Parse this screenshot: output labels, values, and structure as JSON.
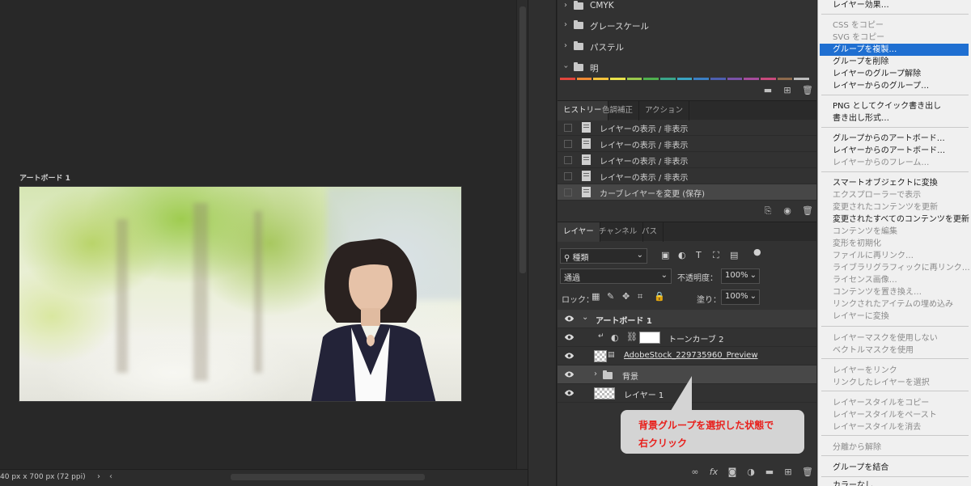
{
  "canvas": {
    "artboard_label": "アートボード 1",
    "status_text": "40 px x 700 px (72 ppi)",
    "status_arrow": "›",
    "scroll_left": "‹"
  },
  "swatches": {
    "groups": [
      {
        "name": "CMYK",
        "expanded": false
      },
      {
        "name": "グレースケール",
        "expanded": false
      },
      {
        "name": "パステル",
        "expanded": false
      },
      {
        "name": "明",
        "expanded": true
      }
    ],
    "strip_colors": [
      "#e2463c",
      "#f08a34",
      "#f5c33b",
      "#e9e24b",
      "#9ac84c",
      "#4fb04e",
      "#3aa58a",
      "#3aa4c2",
      "#3b7fc4",
      "#4d5fb0",
      "#7a52a8",
      "#a64c9c",
      "#c84a7c",
      "#8d6a4c",
      "#bbbbbb"
    ]
  },
  "history": {
    "tabs": [
      "ヒストリー",
      "色調補正",
      "アクション"
    ],
    "items": [
      {
        "label": "レイヤーの表示 / 非表示",
        "current": false
      },
      {
        "label": "レイヤーの表示 / 非表示",
        "current": false
      },
      {
        "label": "レイヤーの表示 / 非表示",
        "current": false
      },
      {
        "label": "レイヤーの表示 / 非表示",
        "current": false
      },
      {
        "label": "カーブレイヤーを変更 (保存)",
        "current": true
      }
    ]
  },
  "layers": {
    "tabs": [
      "レイヤー",
      "チャンネル",
      "パス"
    ],
    "filter_kind": "種類",
    "blend_mode": "通過",
    "opacity_label": "不透明度：",
    "opacity_value": "100%",
    "lock_label": "ロック：",
    "fill_label": "塗り：",
    "fill_value": "100%",
    "rows": [
      {
        "name": "アートボード 1",
        "kind": "artboard"
      },
      {
        "name": "トーンカーブ 2",
        "kind": "adjustment"
      },
      {
        "name": "AdobeStock_229735960_Preview",
        "kind": "smart"
      },
      {
        "name": "背景",
        "kind": "group"
      },
      {
        "name": "レイヤー 1",
        "kind": "pixel"
      }
    ]
  },
  "callout": {
    "line1": "背景グループを選択した状態で",
    "line2": "右クリック"
  },
  "context_menu": {
    "items": [
      {
        "label": "レイヤー効果…",
        "state": "enabled"
      },
      {
        "label": "CSS をコピー",
        "state": "disabled"
      },
      {
        "label": "SVG をコピー",
        "state": "disabled"
      },
      {
        "label": "グループを複製…",
        "state": "highlighted"
      },
      {
        "label": "グループを削除",
        "state": "enabled"
      },
      {
        "label": "レイヤーのグループ解除",
        "state": "enabled"
      },
      {
        "label": "レイヤーからのグループ…",
        "state": "enabled"
      },
      {
        "label": "PNG としてクイック書き出し",
        "state": "enabled"
      },
      {
        "label": "書き出し形式…",
        "state": "enabled"
      },
      {
        "label": "グループからのアートボード…",
        "state": "enabled"
      },
      {
        "label": "レイヤーからのアートボード…",
        "state": "enabled"
      },
      {
        "label": "レイヤーからのフレーム…",
        "state": "disabled"
      },
      {
        "label": "スマートオブジェクトに変換",
        "state": "enabled"
      },
      {
        "label": "エクスプローラーで表示",
        "state": "disabled"
      },
      {
        "label": "変更されたコンテンツを更新",
        "state": "disabled"
      },
      {
        "label": "変更されたすべてのコンテンツを更新",
        "state": "enabled"
      },
      {
        "label": "コンテンツを編集",
        "state": "disabled"
      },
      {
        "label": "変形を初期化",
        "state": "disabled"
      },
      {
        "label": "ファイルに再リンク…",
        "state": "disabled"
      },
      {
        "label": "ライブラリグラフィックに再リンク…",
        "state": "disabled"
      },
      {
        "label": "ライセンス画像…",
        "state": "disabled"
      },
      {
        "label": "コンテンツを置き換え…",
        "state": "disabled"
      },
      {
        "label": "リンクされたアイテムの埋め込み",
        "state": "disabled"
      },
      {
        "label": "レイヤーに変換",
        "state": "disabled"
      },
      {
        "label": "レイヤーマスクを使用しない",
        "state": "disabled"
      },
      {
        "label": "ベクトルマスクを使用",
        "state": "disabled"
      },
      {
        "label": "レイヤーをリンク",
        "state": "disabled"
      },
      {
        "label": "リンクしたレイヤーを選択",
        "state": "disabled"
      },
      {
        "label": "レイヤースタイルをコピー",
        "state": "disabled"
      },
      {
        "label": "レイヤースタイルをペースト",
        "state": "disabled"
      },
      {
        "label": "レイヤースタイルを消去",
        "state": "disabled"
      },
      {
        "label": "分離から解除",
        "state": "disabled"
      },
      {
        "label": "グループを結合",
        "state": "enabled"
      },
      {
        "label": "カラーなし",
        "state": "enabled"
      }
    ]
  },
  "colors": {
    "menu_highlight": "#1f6fd1",
    "callout_text": "#e8201c"
  }
}
